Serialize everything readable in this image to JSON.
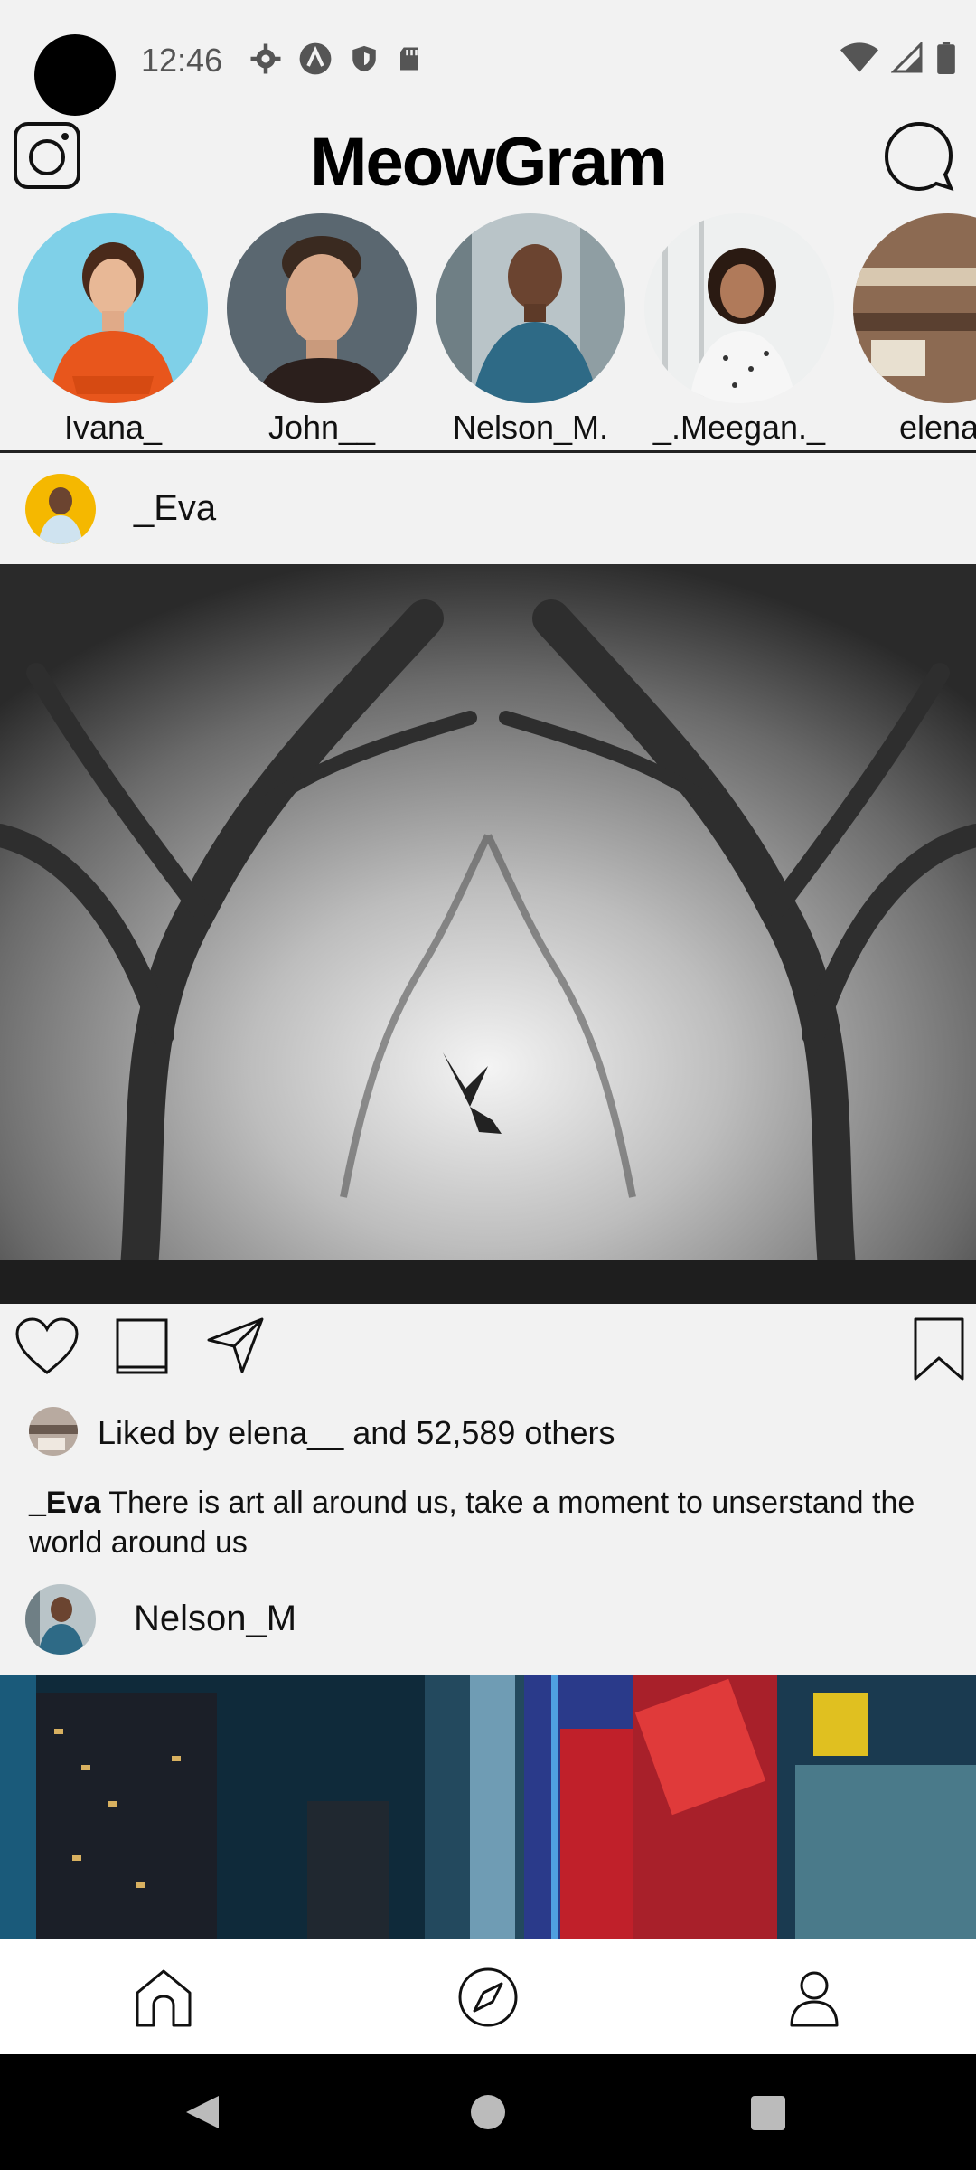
{
  "status_bar": {
    "time": "12:46",
    "icons_left": [
      "settings-icon",
      "a-circle-icon",
      "shield-icon",
      "sd-card-icon"
    ],
    "icons_right": [
      "wifi-icon",
      "cell-signal-icon",
      "battery-icon"
    ]
  },
  "app": {
    "title": "MeowGram"
  },
  "stories": [
    {
      "label": "Ivana_"
    },
    {
      "label": "John__"
    },
    {
      "label": "Nelson_M."
    },
    {
      "label": "_.Meegan._"
    },
    {
      "label": "elena_"
    }
  ],
  "posts": [
    {
      "username": "_Eva",
      "likes_text": "Liked by elena__ and 52,589 others",
      "caption_user": "_Eva",
      "caption_text": "There is art all around us, take a moment to unserstand the world around us"
    },
    {
      "username": "Nelson_M"
    }
  ],
  "bottom_nav": {
    "items": [
      "home-icon",
      "explore-compass-icon",
      "profile-icon"
    ]
  },
  "colors": {
    "background": "#f2f2f2",
    "nav_bg": "#ffffff",
    "system_nav_bg": "#000000"
  }
}
